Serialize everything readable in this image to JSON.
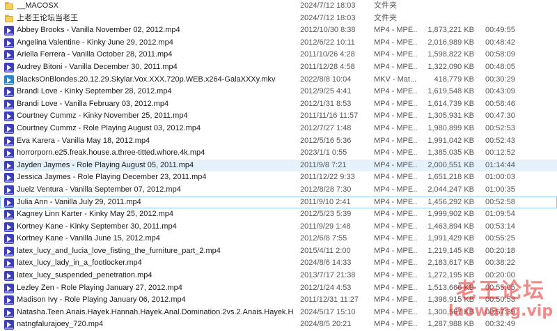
{
  "colors": {
    "folder": "#f7cf5b",
    "video_icon": "#3b3fb8",
    "mkv_icon": "#2a87c8",
    "hover_row": "#e5f1fb",
    "watermark": "#e62828"
  },
  "rows": [
    {
      "name": "__MACOSX",
      "date": "2024/7/12 18:03",
      "type": "文件夹",
      "size": "",
      "duration": "",
      "icon": "folder-icon"
    },
    {
      "name": "上老王论坛当老王",
      "date": "2024/7/12 18:03",
      "type": "文件夹",
      "size": "",
      "duration": "",
      "icon": "folder-icon"
    },
    {
      "name": "Abbey Brooks - Vanilla November 02, 2012.mp4",
      "date": "2012/10/30 8:38",
      "type": "MP4 - MPE...",
      "size": "1,873,221 KB",
      "duration": "00:49:55",
      "icon": "video-file-icon"
    },
    {
      "name": "Angelina Valentine - Kinky June 29, 2012.mp4",
      "date": "2012/6/22 10:11",
      "type": "MP4 - MPE...",
      "size": "2,016,989 KB",
      "duration": "00:48:42",
      "icon": "video-file-icon"
    },
    {
      "name": "Ariella Ferrera - Vanilla October 28, 2011.mp4",
      "date": "2011/10/26 4:28",
      "type": "MP4 - MPE...",
      "size": "1,598,822 KB",
      "duration": "00:58:09",
      "icon": "video-file-icon"
    },
    {
      "name": "Audrey Bitoni - Vanilla December 30, 2011.mp4",
      "date": "2011/12/28 4:58",
      "type": "MP4 - MPE...",
      "size": "1,322,090 KB",
      "duration": "00:48:05",
      "icon": "video-file-icon"
    },
    {
      "name": "BlacksOnBlondes.20.12.29.Skylar.Vox.XXX.720p.WEB.x264-GalaXXXy.mkv",
      "date": "2022/8/8 10:04",
      "type": "MKV - Mat...",
      "size": "418,779 KB",
      "duration": "00:30:29",
      "icon": "mkv-file-icon"
    },
    {
      "name": "Brandi Love - Kinky September 28, 2012.mp4",
      "date": "2012/9/25 4:41",
      "type": "MP4 - MPE...",
      "size": "1,619,548 KB",
      "duration": "00:43:09",
      "icon": "video-file-icon"
    },
    {
      "name": "Brandi Love - Vanilla February 03, 2012.mp4",
      "date": "2012/1/31 8:53",
      "type": "MP4 - MPE...",
      "size": "1,614,739 KB",
      "duration": "00:58:46",
      "icon": "video-file-icon"
    },
    {
      "name": "Courtney Cummz - Kinky November 25, 2011.mp4",
      "date": "2011/11/16 11:57",
      "type": "MP4 - MPE...",
      "size": "1,305,931 KB",
      "duration": "00:47:30",
      "icon": "video-file-icon"
    },
    {
      "name": "Courtney Cummz - Role Playing August 03, 2012.mp4",
      "date": "2012/7/27 1:48",
      "type": "MP4 - MPE...",
      "size": "1,980,899 KB",
      "duration": "00:52:53",
      "icon": "video-file-icon"
    },
    {
      "name": "Eva Karera - Vanilla May 18, 2012.mp4",
      "date": "2012/5/16 5:36",
      "type": "MP4 - MPE...",
      "size": "1,991,042 KB",
      "duration": "00:52:43",
      "icon": "video-file-icon"
    },
    {
      "name": "horrorporn.e25.freak.house.a.three-titted.whore.4k.mp4",
      "date": "2023/1/1 0:55",
      "type": "MP4 - MPE...",
      "size": "1,385,035 KB",
      "duration": "00:12:52",
      "icon": "video-file-icon"
    },
    {
      "name": "Jayden Jaymes - Role Playing August 05, 2011.mp4",
      "date": "2011/9/8 7:21",
      "type": "MP4 - MPE...",
      "size": "2,000,551 KB",
      "duration": "01:14:44",
      "icon": "video-file-icon",
      "state": "hover"
    },
    {
      "name": "Jessica Jaymes - Role Playing December 23, 2011.mp4",
      "date": "2011/12/22 9:33",
      "type": "MP4 - MPE...",
      "size": "1,651,218 KB",
      "duration": "01:00:03",
      "icon": "video-file-icon"
    },
    {
      "name": "Juelz Ventura - Vanilla September 07, 2012.mp4",
      "date": "2012/8/28 7:30",
      "type": "MP4 - MPE...",
      "size": "2,044,247 KB",
      "duration": "01:00:35",
      "icon": "video-file-icon"
    },
    {
      "name": "Julia Ann - Vanilla July 29, 2011.mp4",
      "date": "2011/9/10 2:41",
      "type": "MP4 - MPE...",
      "size": "1,456,292 KB",
      "duration": "00:52:58",
      "icon": "video-file-icon",
      "state": "selected"
    },
    {
      "name": "Kagney Linn Karter - Kinky May 25, 2012.mp4",
      "date": "2012/5/23 5:39",
      "type": "MP4 - MPE...",
      "size": "1,999,902 KB",
      "duration": "01:09:54",
      "icon": "video-file-icon"
    },
    {
      "name": "Kortney Kane - Kinky September 30, 2011.mp4",
      "date": "2011/9/29 1:48",
      "type": "MP4 - MPE...",
      "size": "1,463,894 KB",
      "duration": "00:53:14",
      "icon": "video-file-icon"
    },
    {
      "name": "Kortney Kane - Vanilla June 15, 2012.mp4",
      "date": "2012/6/8 7:55",
      "type": "MP4 - MPE...",
      "size": "1,991,429 KB",
      "duration": "00:55:25",
      "icon": "video-file-icon"
    },
    {
      "name": "latex_lucy_and_lucia_love_fisting_the_furniture_part_2.mp4",
      "date": "2015/4/11 2:00",
      "type": "MP4 - MPE...",
      "size": "1,219,145 KB",
      "duration": "00:20:18",
      "icon": "video-file-icon"
    },
    {
      "name": "latex_lucy_lady_in_a_footlocker.mp4",
      "date": "2024/8/6 14:33",
      "type": "MP4 - MPE...",
      "size": "2,183,617 KB",
      "duration": "00:38:22",
      "icon": "video-file-icon"
    },
    {
      "name": "latex_lucy_suspended_penetration.mp4",
      "date": "2013/7/17 21:38",
      "type": "MP4 - MPE...",
      "size": "1,272,195 KB",
      "duration": "00:20:00",
      "icon": "video-file-icon"
    },
    {
      "name": "Lezley Zen - Role Playing January 27, 2012.mp4",
      "date": "2012/1/24 4:53",
      "type": "MP4 - MPE...",
      "size": "1,513,666 KB",
      "duration": "00:55:05",
      "icon": "video-file-icon"
    },
    {
      "name": "Madison Ivy - Role Playing January 06, 2012.mp4",
      "date": "2011/12/31 11:27",
      "type": "MP4 - MPE...",
      "size": "1,398,915 KB",
      "duration": "00:50:53",
      "icon": "video-file-icon"
    },
    {
      "name": "Natasha.Teen.Anais.Hayek.Hannah.Hayek.Anal.Domination.2vs.2.Anais.Hayek.Ha...",
      "date": "2024/5/17 15:10",
      "type": "MP4 - MPE...",
      "size": "1,300,567 KB",
      "duration": "00:57:39",
      "icon": "video-file-icon"
    },
    {
      "name": "natngfalurajoey_720.mp4",
      "date": "2024/8/5 20:21",
      "type": "MP4 - MPE...",
      "size": "1,287,988 KB",
      "duration": "00:32:49",
      "icon": "video-file-icon"
    }
  ],
  "watermark": {
    "text": "老王论坛",
    "url": "laowang.vip"
  }
}
